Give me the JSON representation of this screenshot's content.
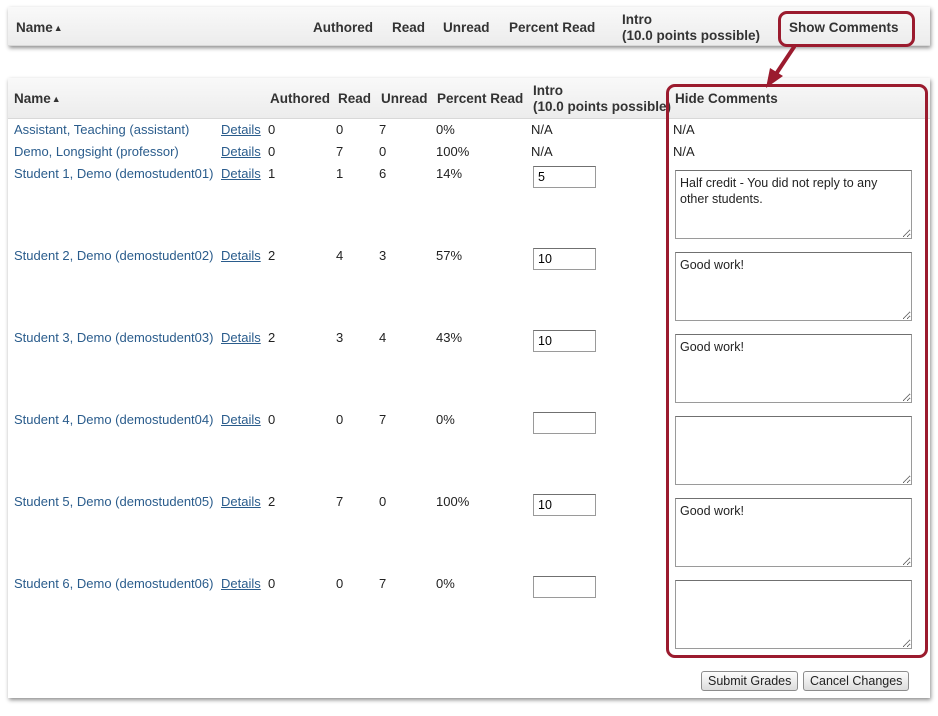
{
  "top_header": {
    "name": "Name",
    "authored": "Authored",
    "read": "Read",
    "unread": "Unread",
    "percent_read": "Percent Read",
    "intro_line1": "Intro",
    "intro_line2": "(10.0 points possible)",
    "show_comments": "Show Comments"
  },
  "header": {
    "name": "Name",
    "authored": "Authored",
    "read": "Read",
    "unread": "Unread",
    "percent_read": "Percent Read",
    "intro_line1": "Intro",
    "intro_line2": "(10.0 points possible)",
    "hide_comments": "Hide Comments"
  },
  "rows": [
    {
      "name": "Assistant, Teaching (assistant)",
      "details": "Details",
      "authored": "0",
      "read": "0",
      "unread": "7",
      "percent": "0%",
      "grade": "N/A",
      "comment": "N/A"
    },
    {
      "name": "Demo, Longsight (professor)",
      "details": "Details",
      "authored": "0",
      "read": "7",
      "unread": "0",
      "percent": "100%",
      "grade": "N/A",
      "comment": "N/A"
    },
    {
      "name": "Student 1, Demo (demostudent01)",
      "details": "Details",
      "authored": "1",
      "read": "1",
      "unread": "6",
      "percent": "14%",
      "grade": "5",
      "comment": "Half credit - You did not reply to any other students."
    },
    {
      "name": "Student 2, Demo (demostudent02)",
      "details": "Details",
      "authored": "2",
      "read": "4",
      "unread": "3",
      "percent": "57%",
      "grade": "10",
      "comment": "Good work!"
    },
    {
      "name": "Student 3, Demo (demostudent03)",
      "details": "Details",
      "authored": "2",
      "read": "3",
      "unread": "4",
      "percent": "43%",
      "grade": "10",
      "comment": "Good work!"
    },
    {
      "name": "Student 4, Demo (demostudent04)",
      "details": "Details",
      "authored": "0",
      "read": "0",
      "unread": "7",
      "percent": "0%",
      "grade": "",
      "comment": ""
    },
    {
      "name": "Student 5, Demo (demostudent05)",
      "details": "Details",
      "authored": "2",
      "read": "7",
      "unread": "0",
      "percent": "100%",
      "grade": "10",
      "comment": "Good work!"
    },
    {
      "name": "Student 6, Demo (demostudent06)",
      "details": "Details",
      "authored": "0",
      "read": "0",
      "unread": "7",
      "percent": "0%",
      "grade": "",
      "comment": ""
    }
  ],
  "buttons": {
    "submit": "Submit Grades",
    "cancel": "Cancel Changes"
  },
  "colors": {
    "highlight": "#9b1b2e",
    "link": "#2a5c8c"
  }
}
